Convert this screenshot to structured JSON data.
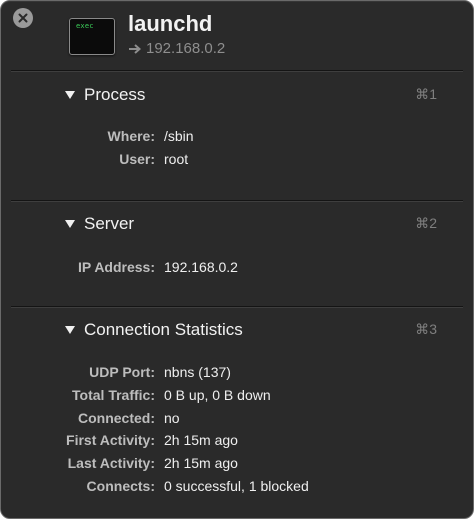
{
  "header": {
    "icon_text": "exec",
    "app_name": "launchd",
    "address": "192.168.0.2"
  },
  "sections": [
    {
      "title": "Process",
      "shortcut": "⌘1",
      "rows": [
        {
          "label": "Where:",
          "value": "/sbin"
        },
        {
          "label": "User:",
          "value": "root"
        }
      ]
    },
    {
      "title": "Server",
      "shortcut": "⌘2",
      "rows": [
        {
          "label": "IP Address:",
          "value": "192.168.0.2"
        }
      ]
    },
    {
      "title": "Connection Statistics",
      "shortcut": "⌘3",
      "rows": [
        {
          "label": "UDP Port:",
          "value": "nbns (137)"
        },
        {
          "label": "Total Traffic:",
          "value": "0 B up, 0 B down"
        },
        {
          "label": "Connected:",
          "value": "no"
        },
        {
          "label": "First Activity:",
          "value": "2h 15m ago"
        },
        {
          "label": "Last Activity:",
          "value": "2h 15m ago"
        },
        {
          "label": "Connects:",
          "value": "0 successful, 1 blocked"
        }
      ]
    }
  ],
  "icons": {
    "close": "close-icon",
    "app": "terminal-exec-icon",
    "address_arrow": "arrow-right-icon",
    "disclosure": "disclosure-triangle-down-icon"
  },
  "colors": {
    "panel_background": "#2a2a2a",
    "panel_border": "#6a6a6a",
    "terminal_text": "#3ccf5a",
    "label_text": "#bdbdbd",
    "value_text": "#efefef",
    "shortcut_text": "#7f7f7f"
  }
}
